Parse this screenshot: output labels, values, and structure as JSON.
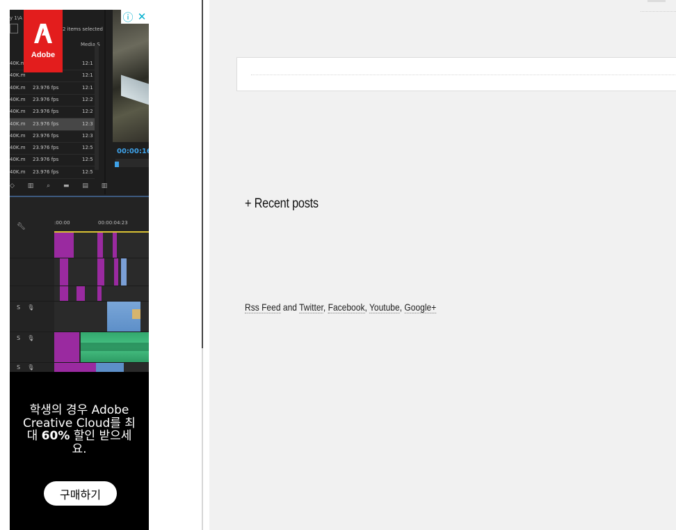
{
  "ad": {
    "brand": "Adobe",
    "headline_part1": "학생의 경우 Adobe Creative Cloud를 최대 ",
    "headline_bold": "60%",
    "headline_part2": " 할인 받으세요.",
    "cta_label": "구매하기",
    "info_icon": "info-icon",
    "close_icon": "close-icon",
    "screenshot": {
      "header_left": "y 1\\A",
      "items_selected": "2 items selected",
      "col_media": "Media S",
      "rows": [
        {
          "name": "40K.m",
          "fps": "",
          "time": "12:1"
        },
        {
          "name": "40K.m",
          "fps": "",
          "time": "12:1"
        },
        {
          "name": "40K.m",
          "fps": "23.976 fps",
          "time": "12:1"
        },
        {
          "name": "40K.m",
          "fps": "23.976 fps",
          "time": "12:2"
        },
        {
          "name": "40K.m",
          "fps": "23.976 fps",
          "time": "12:2"
        },
        {
          "name": "40K.m",
          "fps": "23.976 fps",
          "time": "12:3"
        },
        {
          "name": "40K.m",
          "fps": "23.976 fps",
          "time": "12:3"
        },
        {
          "name": "40K.m",
          "fps": "23.976 fps",
          "time": "12:5"
        },
        {
          "name": "40K.m",
          "fps": "23.976 fps",
          "time": "12:5"
        },
        {
          "name": "40K.m",
          "fps": "23.976 fps",
          "time": "12:5"
        }
      ],
      "timecode": "00:00:16:",
      "ruler_start": ":00:00",
      "ruler_mark": "00:00:04:23"
    }
  },
  "main": {
    "recent_posts_title": "+ Recent posts",
    "social": {
      "rss": "Rss Feed",
      "and": " and ",
      "twitter": "Twitter",
      "facebook": "Facebook",
      "youtube": "Youtube",
      "google": "Google+",
      "sep": ", "
    }
  }
}
